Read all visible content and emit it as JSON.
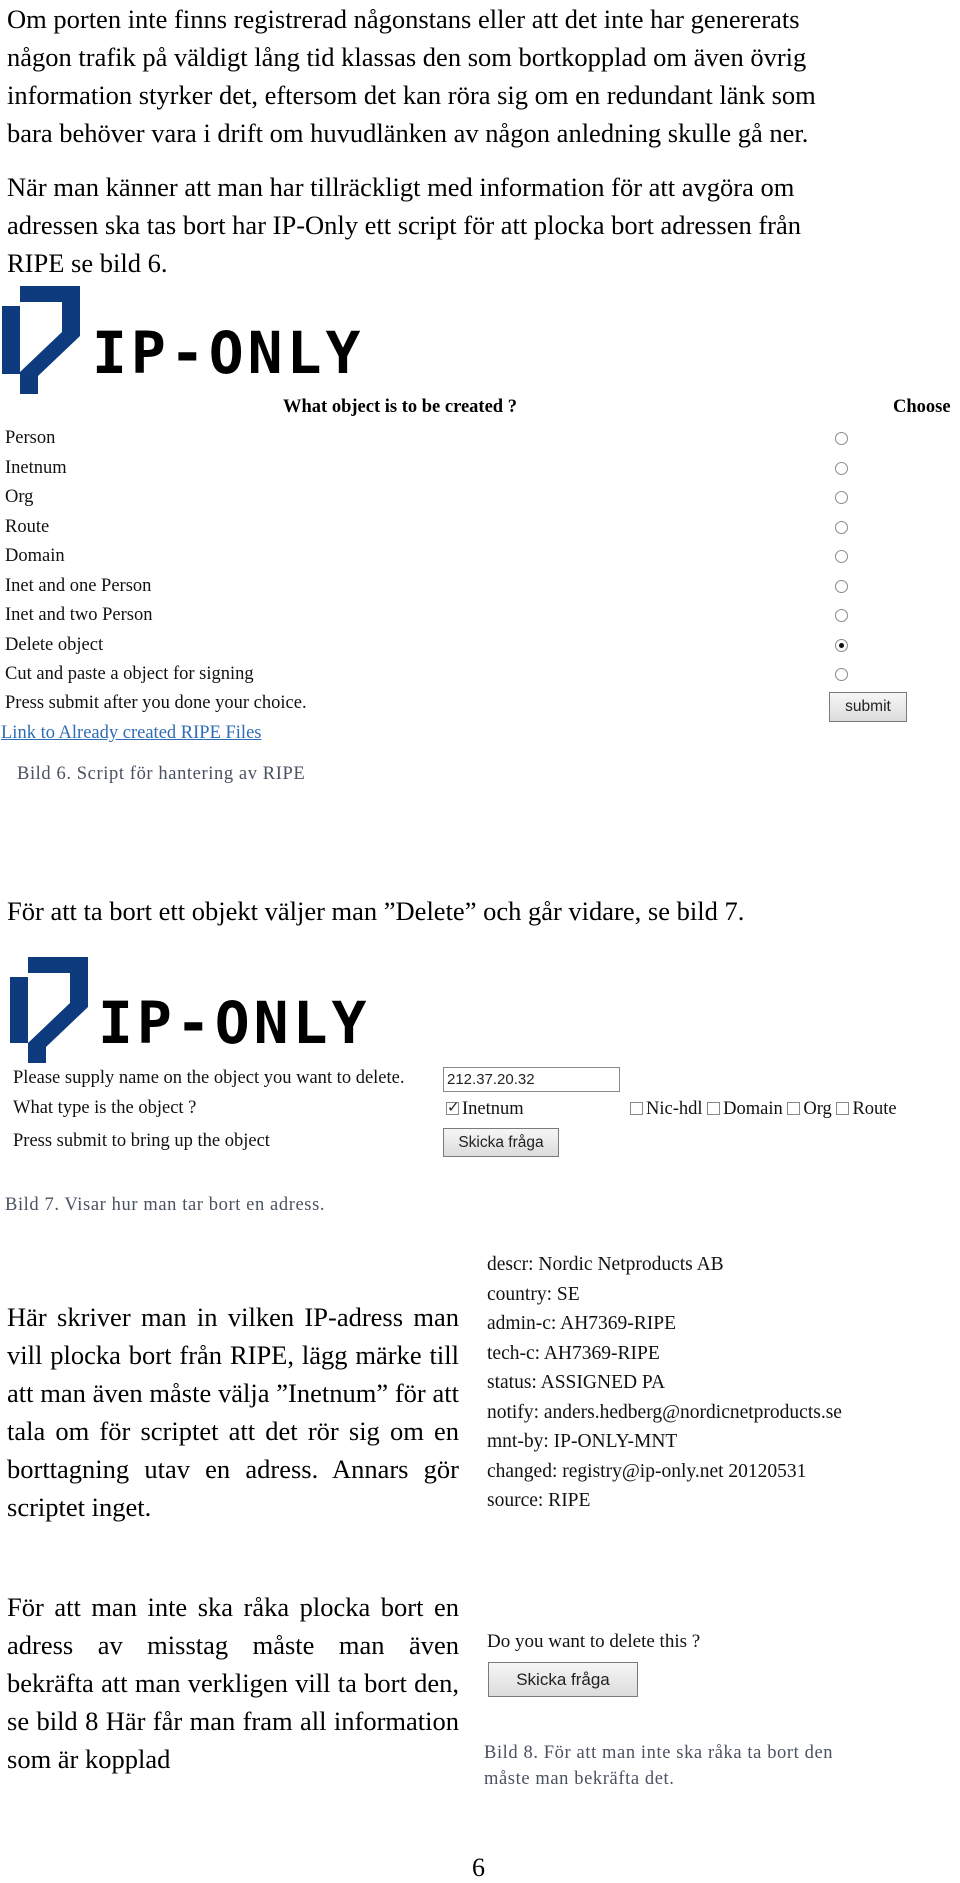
{
  "paragraphs": {
    "intro_1": [
      "Om porten inte finns registrerad någonstans eller att det inte har genererats",
      "någon trafik på väldigt lång tid klassas den som bortkopplad om även övrig",
      "information styrker det, eftersom det kan röra sig om en redundant länk som",
      "bara behöver vara i drift om huvudlänken av någon anledning skulle gå ner."
    ],
    "intro_2": [
      "När man känner att man har tillräckligt med information för att avgöra om",
      "adressen ska tas bort har IP-Only ett script för att plocka bort adressen från",
      "RIPE se bild 6."
    ],
    "delete_intro": "För att ta bort ett objekt väljer man ”Delete” och går vidare, se bild 7.",
    "left_col_1": "Här skriver man in vilken IP-adress man vill plocka bort från RIPE, lägg märke till att man även måste välja ”Inetnum” för att tala om för scriptet att det rör sig om en borttagning utav en adress. Annars gör scriptet inget.",
    "left_col_2": "För att man inte ska råka plocka bort en adress av misstag måste man även bekräfta att man verkligen vill ta bort den, se bild 8 Här får man fram all information som är kopplad"
  },
  "logo": {
    "text": "IP-ONLY",
    "brand_color": "#0d3b7e",
    "text_color": "#000000"
  },
  "figure6": {
    "heading": "What object is to be created ?",
    "choose_label": "Choose",
    "options": [
      {
        "label": "Person",
        "selected": false
      },
      {
        "label": "Inetnum",
        "selected": false
      },
      {
        "label": "Org",
        "selected": false
      },
      {
        "label": "Route",
        "selected": false
      },
      {
        "label": "Domain",
        "selected": false
      },
      {
        "label": "Inet and one Person",
        "selected": false
      },
      {
        "label": "Inet and two Person",
        "selected": false
      },
      {
        "label": "Delete object",
        "selected": true
      },
      {
        "label": "Cut and paste a object for signing",
        "selected": false
      }
    ],
    "instruction": "Press submit after you done your choice.",
    "submit_label": "submit",
    "link_label": "Link to Already created RIPE Files",
    "link_color": "#2e6db5",
    "caption": "Bild 6. Script för hantering av RIPE"
  },
  "figure7": {
    "name_prompt": "Please supply name on the object you want to delete.",
    "name_value": "212.37.20.32",
    "type_prompt": "What type is the object ?",
    "types": [
      {
        "label": "Inetnum",
        "checked": true
      },
      {
        "label": "Nic-hdl",
        "checked": false
      },
      {
        "label": "Domain",
        "checked": false
      },
      {
        "label": "Org",
        "checked": false
      },
      {
        "label": "Route",
        "checked": false
      }
    ],
    "submit_prompt": "Press submit to bring up the object",
    "submit_label": "Skicka fråga",
    "caption": "Bild 7. Visar hur man tar bort en adress."
  },
  "figure8": {
    "ripe_lines": [
      "descr: Nordic Netproducts AB",
      "country: SE",
      "admin-c: AH7369-RIPE",
      "tech-c: AH7369-RIPE",
      "status: ASSIGNED PA",
      "notify: anders.hedberg@nordicnetproducts.se",
      "mnt-by: IP-ONLY-MNT",
      "changed: registry@ip-only.net 20120531",
      "source: RIPE"
    ],
    "confirm_prompt": "Do you want to delete this ?",
    "submit_label": "Skicka fråga",
    "caption_lines": [
      "Bild 8. För att man inte ska råka ta bort den",
      "måste man bekräfta det."
    ],
    "caption_color": "#4a5160"
  },
  "page_number": "6"
}
